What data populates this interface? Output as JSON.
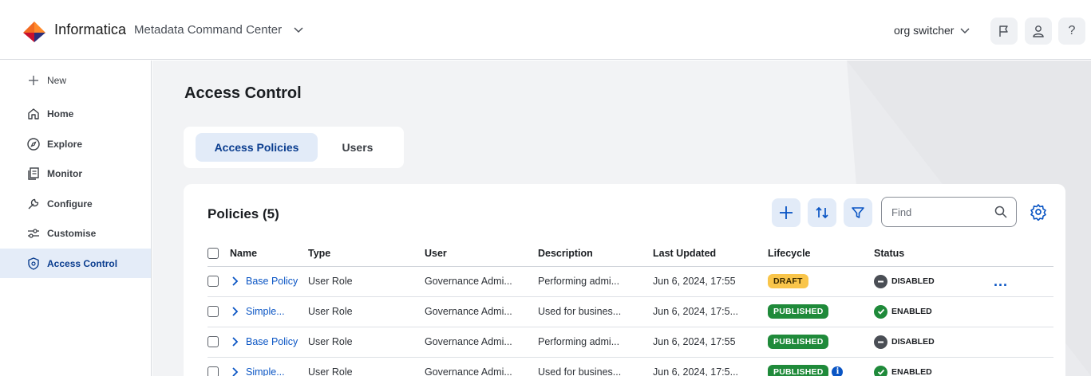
{
  "header": {
    "brand": "Informatica",
    "product": "Metadata Command Center",
    "org_switcher": "org switcher",
    "help_label": "?"
  },
  "sidebar": {
    "items": [
      {
        "label": "New",
        "icon": "plus-icon"
      },
      {
        "label": "Home",
        "icon": "home-icon"
      },
      {
        "label": "Explore",
        "icon": "compass-icon"
      },
      {
        "label": "Monitor",
        "icon": "monitor-icon"
      },
      {
        "label": "Configure",
        "icon": "wrench-icon"
      },
      {
        "label": "Customise",
        "icon": "sliders-icon"
      },
      {
        "label": "Access Control",
        "icon": "shield-icon",
        "active": true
      }
    ]
  },
  "main": {
    "title": "Access Control",
    "tabs": [
      {
        "label": "Access Policies",
        "active": true
      },
      {
        "label": "Users",
        "active": false
      }
    ],
    "policies": {
      "title": "Policies (5)",
      "find_placeholder": "Find",
      "columns": [
        "Name",
        "Type",
        "User",
        "Description",
        "Last Updated",
        "Lifecycle",
        "Status"
      ],
      "rows": [
        {
          "name": "Base Policy",
          "type": "User Role",
          "user": "Governance Admi...",
          "description": "Performing admi...",
          "last_updated": "Jun 6, 2024, 17:55",
          "lifecycle": "DRAFT",
          "status": "DISABLED",
          "more": "..."
        },
        {
          "name": "Simple...",
          "type": "User Role",
          "user": "Governance Admi...",
          "description": "Used for busines...",
          "last_updated": "Jun 6, 2024, 17:5...",
          "lifecycle": "PUBLISHED",
          "status": "ENABLED"
        },
        {
          "name": "Base Policy",
          "type": "User Role",
          "user": "Governance Admi...",
          "description": "Performing admi...",
          "last_updated": "Jun 6, 2024, 17:55",
          "lifecycle": "PUBLISHED",
          "status": "DISABLED"
        },
        {
          "name": "Simple...",
          "type": "User Role",
          "user": "Governance Admi...",
          "description": "Used for busines...",
          "last_updated": "Jun 6, 2024, 17:5...",
          "lifecycle": "PUBLISHED",
          "status": "ENABLED",
          "info": "i"
        }
      ]
    }
  },
  "colors": {
    "accent": "#0a55c4",
    "active_bg": "#e2ebf8",
    "draft": "#f9c54a",
    "published": "#1f8a3a",
    "disabled": "#4a4e55"
  }
}
